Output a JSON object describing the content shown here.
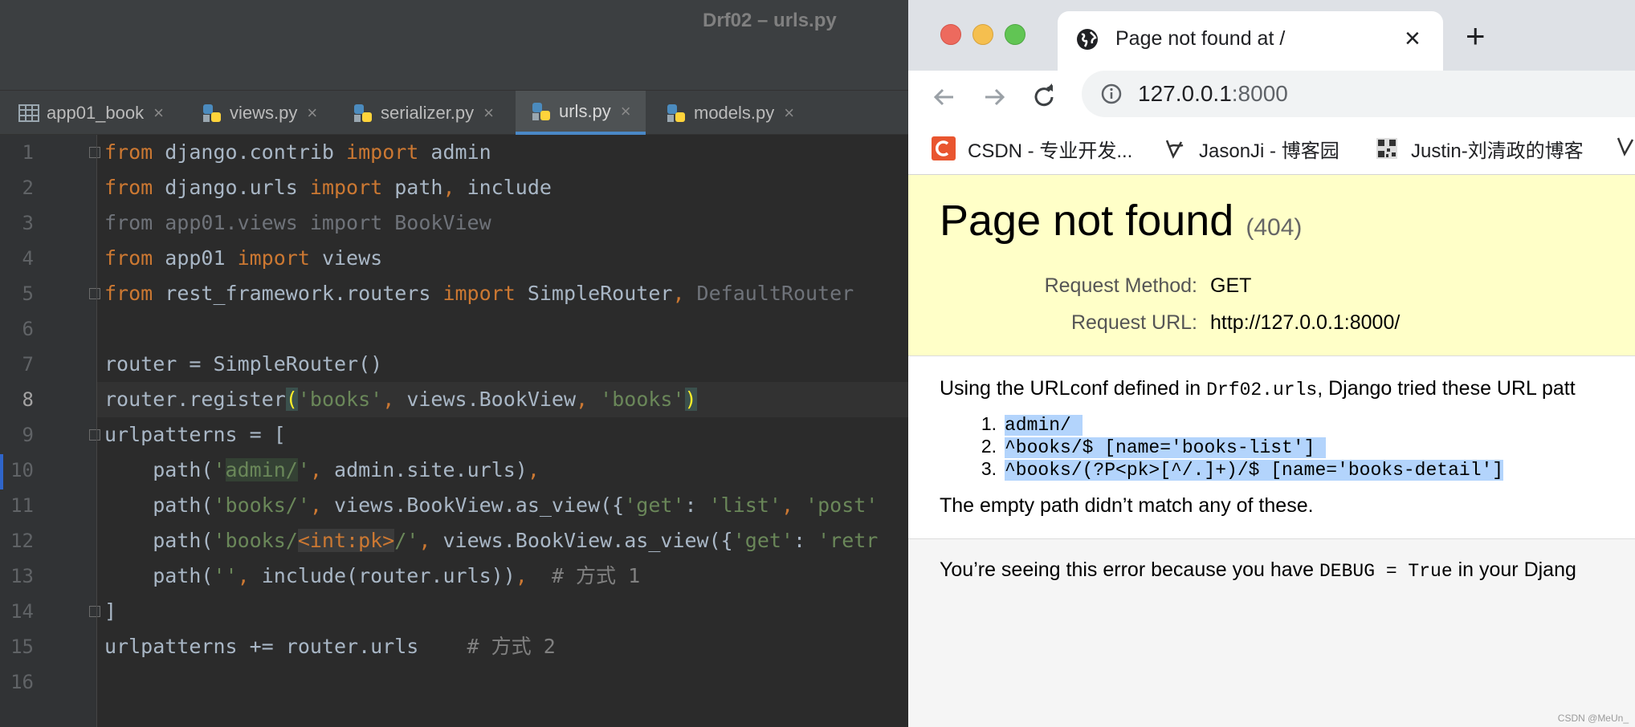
{
  "ide": {
    "window_title": "Drf02 – urls.py",
    "tabs": [
      {
        "label": "app01_book",
        "icon": "table-icon"
      },
      {
        "label": "views.py",
        "icon": "python-icon"
      },
      {
        "label": "serializer.py",
        "icon": "python-icon"
      },
      {
        "label": "urls.py",
        "icon": "python-icon",
        "active": true
      },
      {
        "label": "models.py",
        "icon": "python-icon"
      }
    ],
    "tab_close": "×",
    "line_numbers": [
      "1",
      "2",
      "3",
      "4",
      "5",
      "6",
      "7",
      "8",
      "9",
      "10",
      "11",
      "12",
      "13",
      "14",
      "15",
      "16"
    ],
    "current_line": "8",
    "code": {
      "l1": {
        "a": "from",
        "b": " django.contrib ",
        "c": "import",
        "d": " admin"
      },
      "l2": {
        "a": "from",
        "b": " django.urls ",
        "c": "import",
        "d": " path",
        "e": ",",
        "f": " include"
      },
      "l3": "from app01.views import BookView",
      "l4": {
        "a": "from",
        "b": " app01 ",
        "c": "import",
        "d": " views"
      },
      "l5": {
        "a": "from",
        "b": " rest_framework.routers ",
        "c": "import",
        "d": " SimpleRouter",
        "e": ", ",
        "f": "DefaultRouter"
      },
      "l7": "router = SimpleRouter()",
      "l8": {
        "a": "router.register",
        "b": "(",
        "c": "'books'",
        "d": ",",
        "e": " views.BookView",
        "f": ",",
        "g": " ",
        "h": "'books'",
        "i": ")"
      },
      "l9": "urlpatterns = [",
      "l10": {
        "a": "    path(",
        "b": "'",
        "c": "admin/",
        "d": "'",
        "e": ",",
        "f": " admin.site.urls)",
        "g": ","
      },
      "l11": {
        "a": "    path(",
        "b": "'books/'",
        "c": ",",
        "d": " views.BookView.as_view({",
        "e": "'get'",
        "f": ": ",
        "g": "'list'",
        "h": ", ",
        "i": "'post'"
      },
      "l12": {
        "a": "    path(",
        "b": "'books/",
        "c": "<int:pk>",
        "d": "/'",
        "e": ",",
        "f": " views.BookView.as_view({",
        "g": "'get'",
        "h": ": ",
        "i": "'retr"
      },
      "l13": {
        "a": "    path(",
        "b": "''",
        "c": ",",
        "d": " include(router.urls))",
        "e": ",",
        "f": "  ",
        "g": "# 方式 1"
      },
      "l14": "]",
      "l15": {
        "a": "urlpatterns += router.urls    ",
        "b": "# 方式 2"
      }
    }
  },
  "browser": {
    "tab_title": "Page not found at /",
    "tab_close": "×",
    "new_tab": "+",
    "url_host": "127.0.0.1",
    "url_port": ":8000",
    "bookmarks": [
      {
        "label": "CSDN - 专业开发...",
        "icon": "csdn-icon"
      },
      {
        "label": "JasonJi - 博客园",
        "icon": "cnblogs-icon"
      },
      {
        "label": "Justin-刘清政的博客",
        "icon": "qr-icon"
      }
    ],
    "colors": {
      "accent": "#4a88c7",
      "error_header": "#ffffc8",
      "selection": "#b3d4fc"
    }
  },
  "django": {
    "title": "Page not found",
    "status_code": "(404)",
    "request_method_label": "Request Method:",
    "request_method": "GET",
    "request_url_label": "Request URL:",
    "request_url": "http://127.0.0.1:8000/",
    "urlconf_pre": "Using the URLconf defined in ",
    "urlconf_module": "Drf02.urls",
    "urlconf_post": ", Django tried these URL patt",
    "patterns": [
      {
        "num": "1.",
        "text": "admin/ "
      },
      {
        "num": "2.",
        "text": "^books/$ [name='books-list'] "
      },
      {
        "num": "3.",
        "text": "^books/(?P<pk>[^/.]+)/$ [name='books-detail']"
      }
    ],
    "no_match": "The empty path didn’t match any of these.",
    "debug_pre": "You’re seeing this error because you have ",
    "debug_code": "DEBUG = True",
    "debug_post": " in your Djang"
  },
  "watermark": "CSDN @MeUn_"
}
